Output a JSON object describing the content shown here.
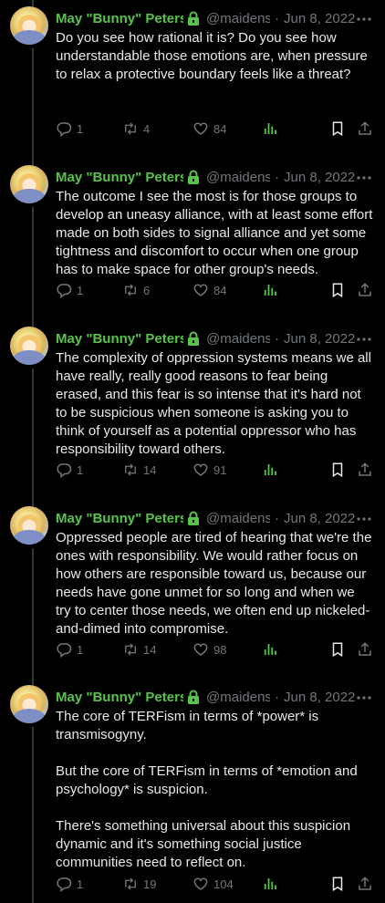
{
  "author": {
    "display_name": "May \"Bunny\" Peters",
    "handle": "@maidens",
    "protected_icon": "lock-icon",
    "name_color": "#58c34a"
  },
  "icons": {
    "more": "more-horizontal-icon",
    "reply": "reply-icon",
    "retweet": "retweet-icon",
    "like": "heart-icon",
    "views": "views-bar-chart-icon",
    "bookmark": "bookmark-icon",
    "share": "share-icon"
  },
  "tweets": [
    {
      "date": "Jun 8, 2022",
      "text": "Do you see how rational it is? Do you see how understandable those emotions are, when pressure to relax a protective boundary feels like a threat?",
      "replies": "1",
      "retweets": "4",
      "likes": "84"
    },
    {
      "date": "Jun 8, 2022",
      "text": "The outcome I see the most is for those groups to develop an uneasy alliance, with at least some effort made on both sides to signal alliance and yet some tightness and discomfort to occur when one group has to make space for other group's needs.",
      "replies": "1",
      "retweets": "6",
      "likes": "84"
    },
    {
      "date": "Jun 8, 2022",
      "text": "The complexity of oppression systems means we all have really, really good reasons to fear being erased, and this fear is so intense that it's hard not to be suspicious when someone is asking you to think of yourself as a potential oppressor who has responsibility toward others.",
      "replies": "1",
      "retweets": "14",
      "likes": "91"
    },
    {
      "date": "Jun 8, 2022",
      "text": "Oppressed people are tired of hearing that we're the ones with responsibility. We would rather focus on how others are responsible toward us, because our needs have gone unmet for so long and when we try to center those needs, we often end up nickeled-and-dimed into compromise.",
      "replies": "1",
      "retweets": "14",
      "likes": "98"
    },
    {
      "date": "Jun 8, 2022",
      "text": "The core of TERFism in terms of *power* is transmisogyny.\n\nBut the core of TERFism in terms of *emotion and psychology* is suspicion.\n\nThere's something universal about this suspicion dynamic and it's something social justice communities need to reflect on.",
      "replies": "1",
      "retweets": "19",
      "likes": "104"
    }
  ]
}
